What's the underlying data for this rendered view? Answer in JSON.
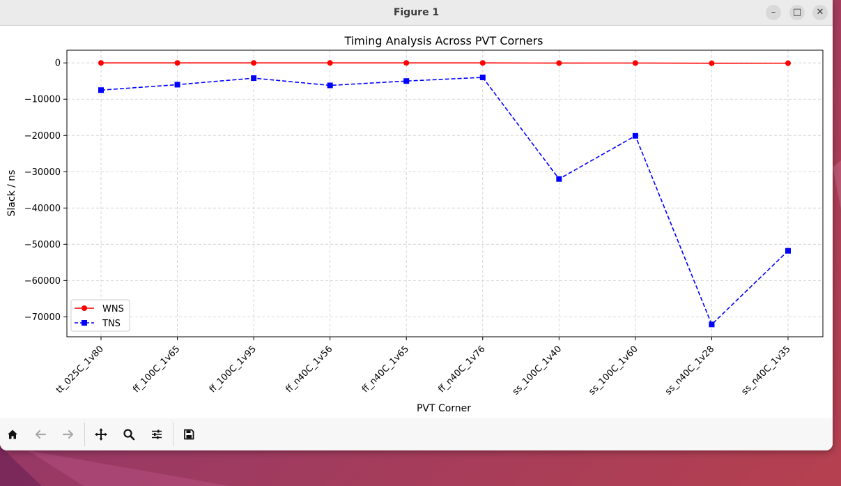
{
  "window": {
    "title": "Figure 1",
    "minimize_label": "–",
    "maximize_label": "□",
    "close_label": "✕"
  },
  "toolbar": {
    "buttons": [
      {
        "name": "home-icon",
        "enabled": true
      },
      {
        "name": "back-arrow-icon",
        "enabled": false
      },
      {
        "name": "forward-arrow-icon",
        "enabled": false
      },
      {
        "name": "pan-move-icon",
        "enabled": true
      },
      {
        "name": "zoom-magnifier-icon",
        "enabled": true
      },
      {
        "name": "configure-subplots-icon",
        "enabled": true
      },
      {
        "name": "save-floppy-icon",
        "enabled": true
      }
    ]
  },
  "chart_data": {
    "type": "line",
    "title": "Timing Analysis Across PVT Corners",
    "xlabel": "PVT Corner",
    "ylabel": "Slack / ns",
    "categories": [
      "tt_025C_1v80",
      "ff_100C_1v65",
      "ff_100C_1v95",
      "ff_n40C_1v56",
      "ff_n40C_1v65",
      "ff_n40C_1v76",
      "ss_100C_1v40",
      "ss_100C_1v60",
      "ss_n40C_1v28",
      "ss_n40C_1v35"
    ],
    "series": [
      {
        "name": "WNS",
        "color": "#ff0000",
        "marker": "circle",
        "linestyle": "solid",
        "values": [
          0,
          0,
          0,
          0,
          0,
          0,
          -50,
          -30,
          -100,
          -80
        ]
      },
      {
        "name": "TNS",
        "color": "#0000ff",
        "marker": "square",
        "linestyle": "dashed",
        "values": [
          -7500,
          -6000,
          -4200,
          -6200,
          -5000,
          -4000,
          -32000,
          -20100,
          -72100,
          -51800
        ]
      }
    ],
    "ylim": [
      -75500,
      3500
    ],
    "yticks": [
      0,
      -10000,
      -20000,
      -30000,
      -40000,
      -50000,
      -60000,
      -70000
    ],
    "ytick_labels": [
      "0",
      "−10000",
      "−20000",
      "−30000",
      "−40000",
      "−50000",
      "−60000",
      "−70000"
    ],
    "grid": true,
    "legend_position": "lower-left"
  }
}
